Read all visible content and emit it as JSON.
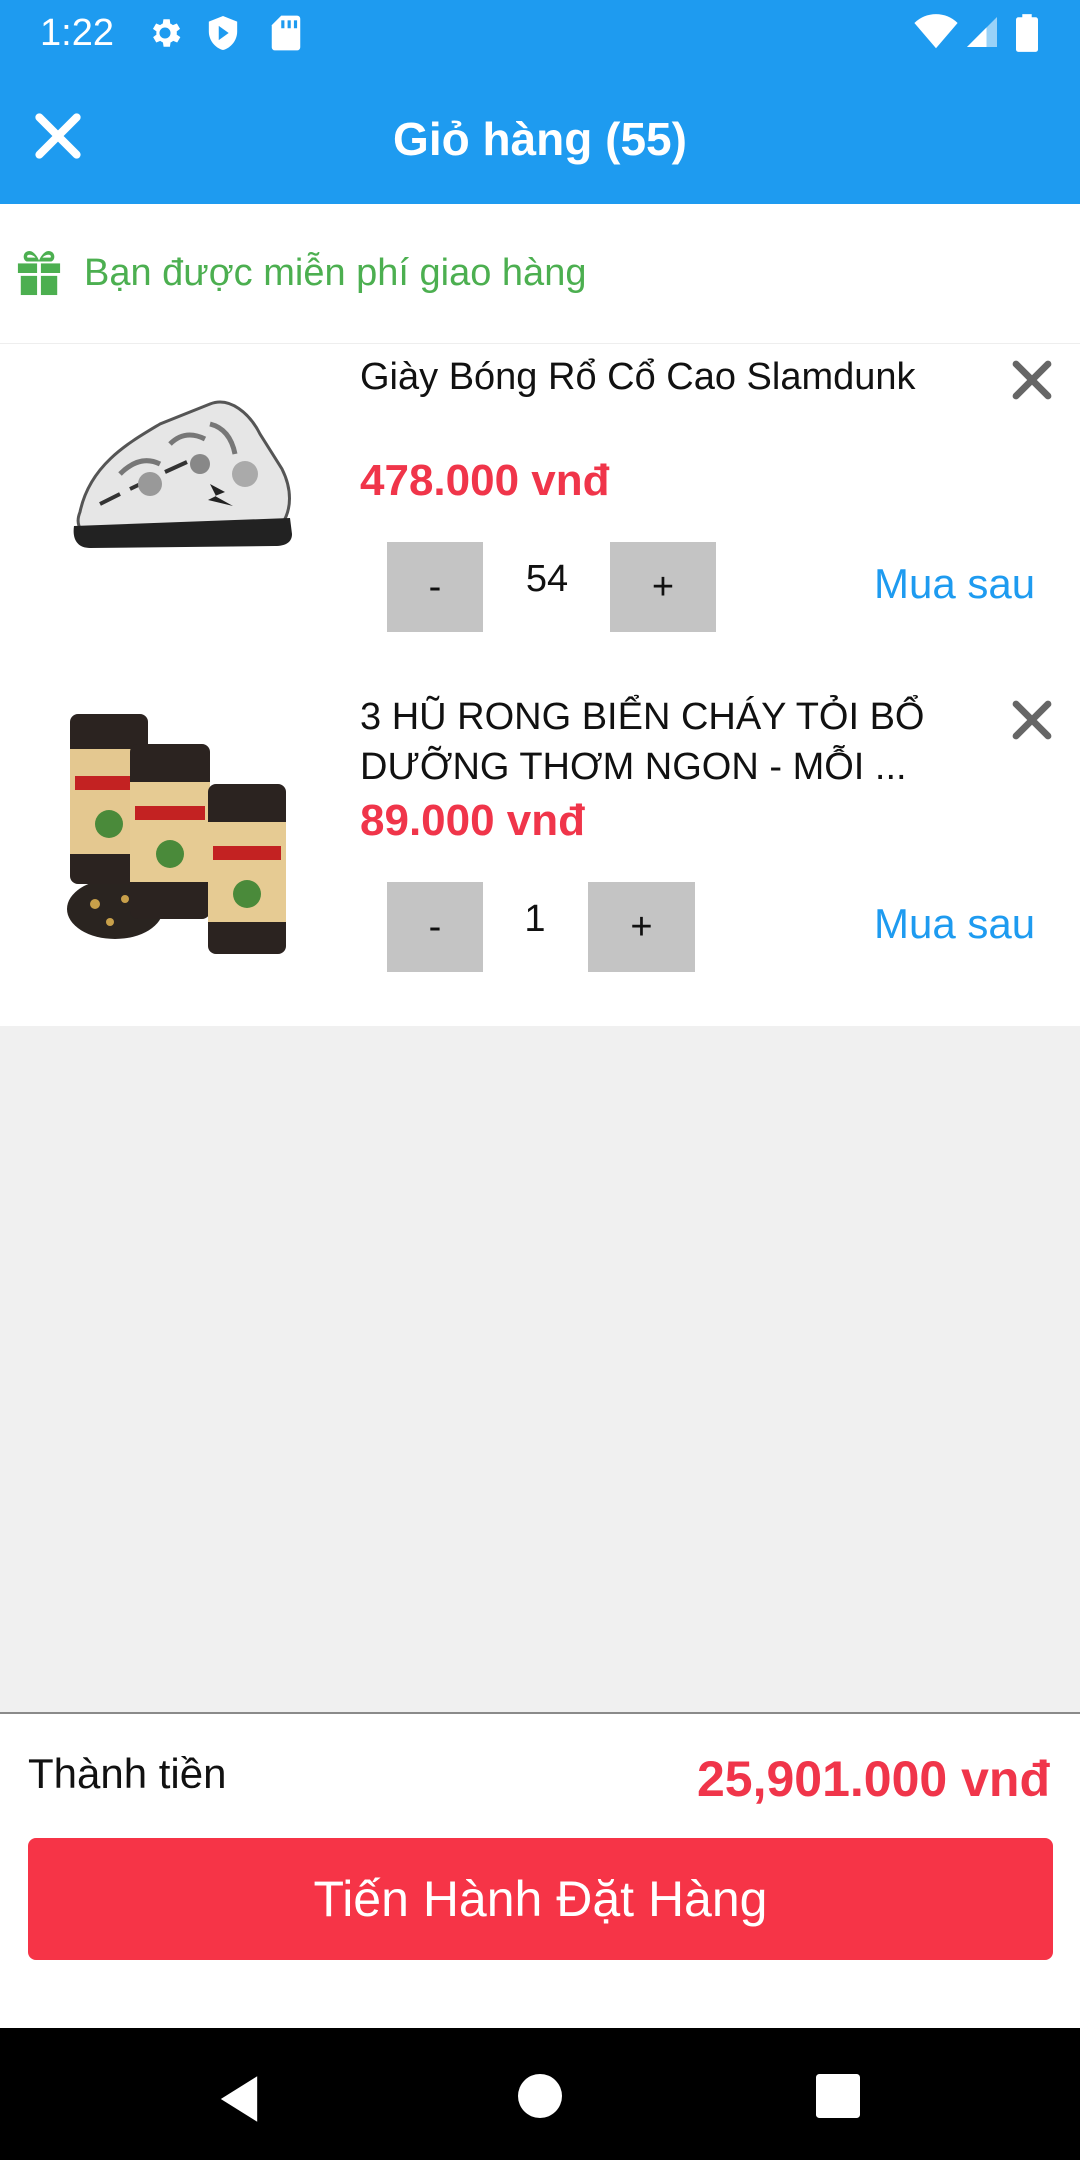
{
  "status_bar": {
    "time": "1:22",
    "icons": [
      "gear-icon",
      "shield-icon",
      "sd-card-icon",
      "wifi-icon",
      "signal-icon",
      "battery-icon"
    ]
  },
  "header": {
    "title": "Giỏ hàng (55)",
    "close_icon": "close-icon"
  },
  "shipping_notice": {
    "text": "Bạn được miễn phí giao hàng",
    "icon": "gift-icon"
  },
  "cart_items": [
    {
      "name": "Giày Bóng Rổ Cổ Cao Slamdunk",
      "price": "478.000 vnđ",
      "decrement": "-",
      "quantity": "54",
      "increment": "+",
      "buy_later": "Mua sau"
    },
    {
      "name": "3 HŨ RONG BIỂN CHÁY TỎI BỔ DƯỠNG THƠM NGON - MỖI ...",
      "price": "89.000 vnđ",
      "decrement": "-",
      "quantity": "1",
      "increment": "+",
      "buy_later": "Mua sau"
    }
  ],
  "summary": {
    "total_label": "Thành tiền",
    "total_value": "25,901.000 vnđ",
    "checkout_label": "Tiến Hành Đặt Hàng"
  },
  "colors": {
    "primary": "#1e9bf0",
    "price": "#f0354a",
    "checkout": "#f63447",
    "free_shipping": "#4caf50"
  }
}
